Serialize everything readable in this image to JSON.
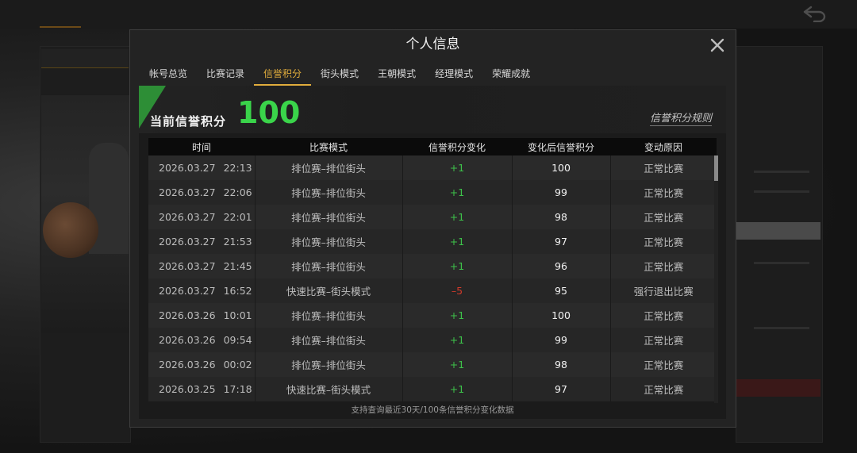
{
  "modal": {
    "title": "个人信息"
  },
  "tabs": [
    {
      "label": "帐号总览",
      "active": false
    },
    {
      "label": "比赛记录",
      "active": false
    },
    {
      "label": "信誉积分",
      "active": true
    },
    {
      "label": "街头模式",
      "active": false
    },
    {
      "label": "王朝模式",
      "active": false
    },
    {
      "label": "经理模式",
      "active": false
    },
    {
      "label": "荣耀成就",
      "active": false
    }
  ],
  "credit": {
    "label": "当前信誉积分",
    "score": "100",
    "rules_link": "信誉积分规则"
  },
  "table": {
    "headers": [
      "时间",
      "比赛模式",
      "信誉积分变化",
      "变化后信誉积分",
      "变动原因"
    ],
    "rows": [
      {
        "date": "2026.03.27",
        "time": "22:13",
        "mode": "排位赛–排位街头",
        "change": "+1",
        "sign": "pos",
        "after": "100",
        "reason": "正常比赛"
      },
      {
        "date": "2026.03.27",
        "time": "22:06",
        "mode": "排位赛–排位街头",
        "change": "+1",
        "sign": "pos",
        "after": "99",
        "reason": "正常比赛"
      },
      {
        "date": "2026.03.27",
        "time": "22:01",
        "mode": "排位赛–排位街头",
        "change": "+1",
        "sign": "pos",
        "after": "98",
        "reason": "正常比赛"
      },
      {
        "date": "2026.03.27",
        "time": "21:53",
        "mode": "排位赛–排位街头",
        "change": "+1",
        "sign": "pos",
        "after": "97",
        "reason": "正常比赛"
      },
      {
        "date": "2026.03.27",
        "time": "21:45",
        "mode": "排位赛–排位街头",
        "change": "+1",
        "sign": "pos",
        "after": "96",
        "reason": "正常比赛"
      },
      {
        "date": "2026.03.27",
        "time": "16:52",
        "mode": "快速比赛–街头模式",
        "change": "–5",
        "sign": "neg",
        "after": "95",
        "reason": "强行退出比赛"
      },
      {
        "date": "2026.03.26",
        "time": "10:01",
        "mode": "排位赛–排位街头",
        "change": "+1",
        "sign": "pos",
        "after": "100",
        "reason": "正常比赛"
      },
      {
        "date": "2026.03.26",
        "time": "09:54",
        "mode": "排位赛–排位街头",
        "change": "+1",
        "sign": "pos",
        "after": "99",
        "reason": "正常比赛"
      },
      {
        "date": "2026.03.26",
        "time": "00:02",
        "mode": "排位赛–排位街头",
        "change": "+1",
        "sign": "pos",
        "after": "98",
        "reason": "正常比赛"
      },
      {
        "date": "2026.03.25",
        "time": "17:18",
        "mode": "快速比赛–街头模式",
        "change": "+1",
        "sign": "pos",
        "after": "97",
        "reason": "正常比赛"
      }
    ]
  },
  "footer_note": "支持查询最近30天/100条信誉积分变化数据",
  "colors": {
    "accent_tab": "#e0ac3c",
    "score_green": "#3ad44a",
    "change_positive": "#3dc24a",
    "change_negative": "#d23a2a",
    "banner_green": "#2f9a38"
  },
  "icons": {
    "close": "close-icon",
    "back": "back-arrow-icon"
  }
}
